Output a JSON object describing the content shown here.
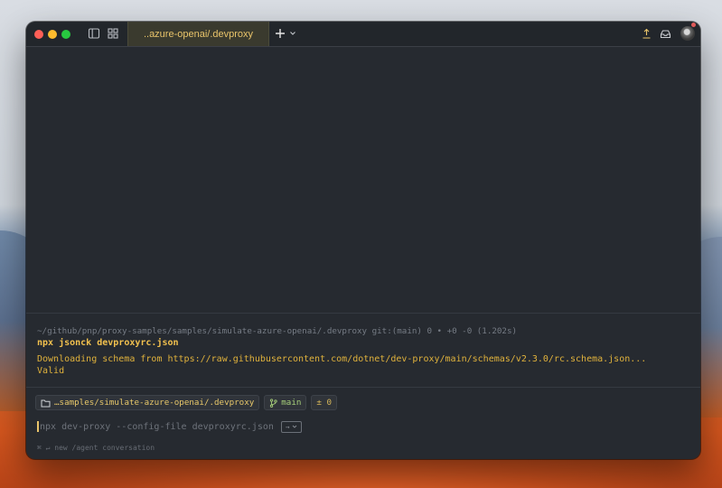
{
  "window": {
    "tab_title": "..azure-openai/.devproxy"
  },
  "block": {
    "prompt_path": "~/github/pnp/proxy-samples/samples/simulate-azure-openai/.devproxy git:(main) 0 • +0 -0 (1.202s)",
    "command": "npx jsonck devproxyrc.json",
    "output_lines": [
      "Downloading schema from https://raw.githubusercontent.com/dotnet/dev-proxy/main/schemas/v2.3.0/rc.schema.json...",
      "Valid"
    ]
  },
  "context_chips": {
    "directory": "…samples/simulate-azure-openai/.devproxy",
    "branch": "main",
    "diff": "± 0"
  },
  "input": {
    "suggestion": "npx dev-proxy --config-file devproxyrc.json",
    "accept_key": "→"
  },
  "hint": "⌘ ↵ new /agent conversation",
  "icons": {
    "sidebar": "sidebar-toggle-icon",
    "grid": "grid-icon",
    "new_tab": "plus-icon",
    "tab_menu": "chevron-down-icon",
    "share": "upload-icon",
    "inbox": "inbox-icon",
    "folder": "folder-icon",
    "branch": "git-branch-icon"
  },
  "colors": {
    "accent": "#e9c46a",
    "background": "#262a30",
    "command": "#f2c14e",
    "branch": "#a7d07a"
  }
}
